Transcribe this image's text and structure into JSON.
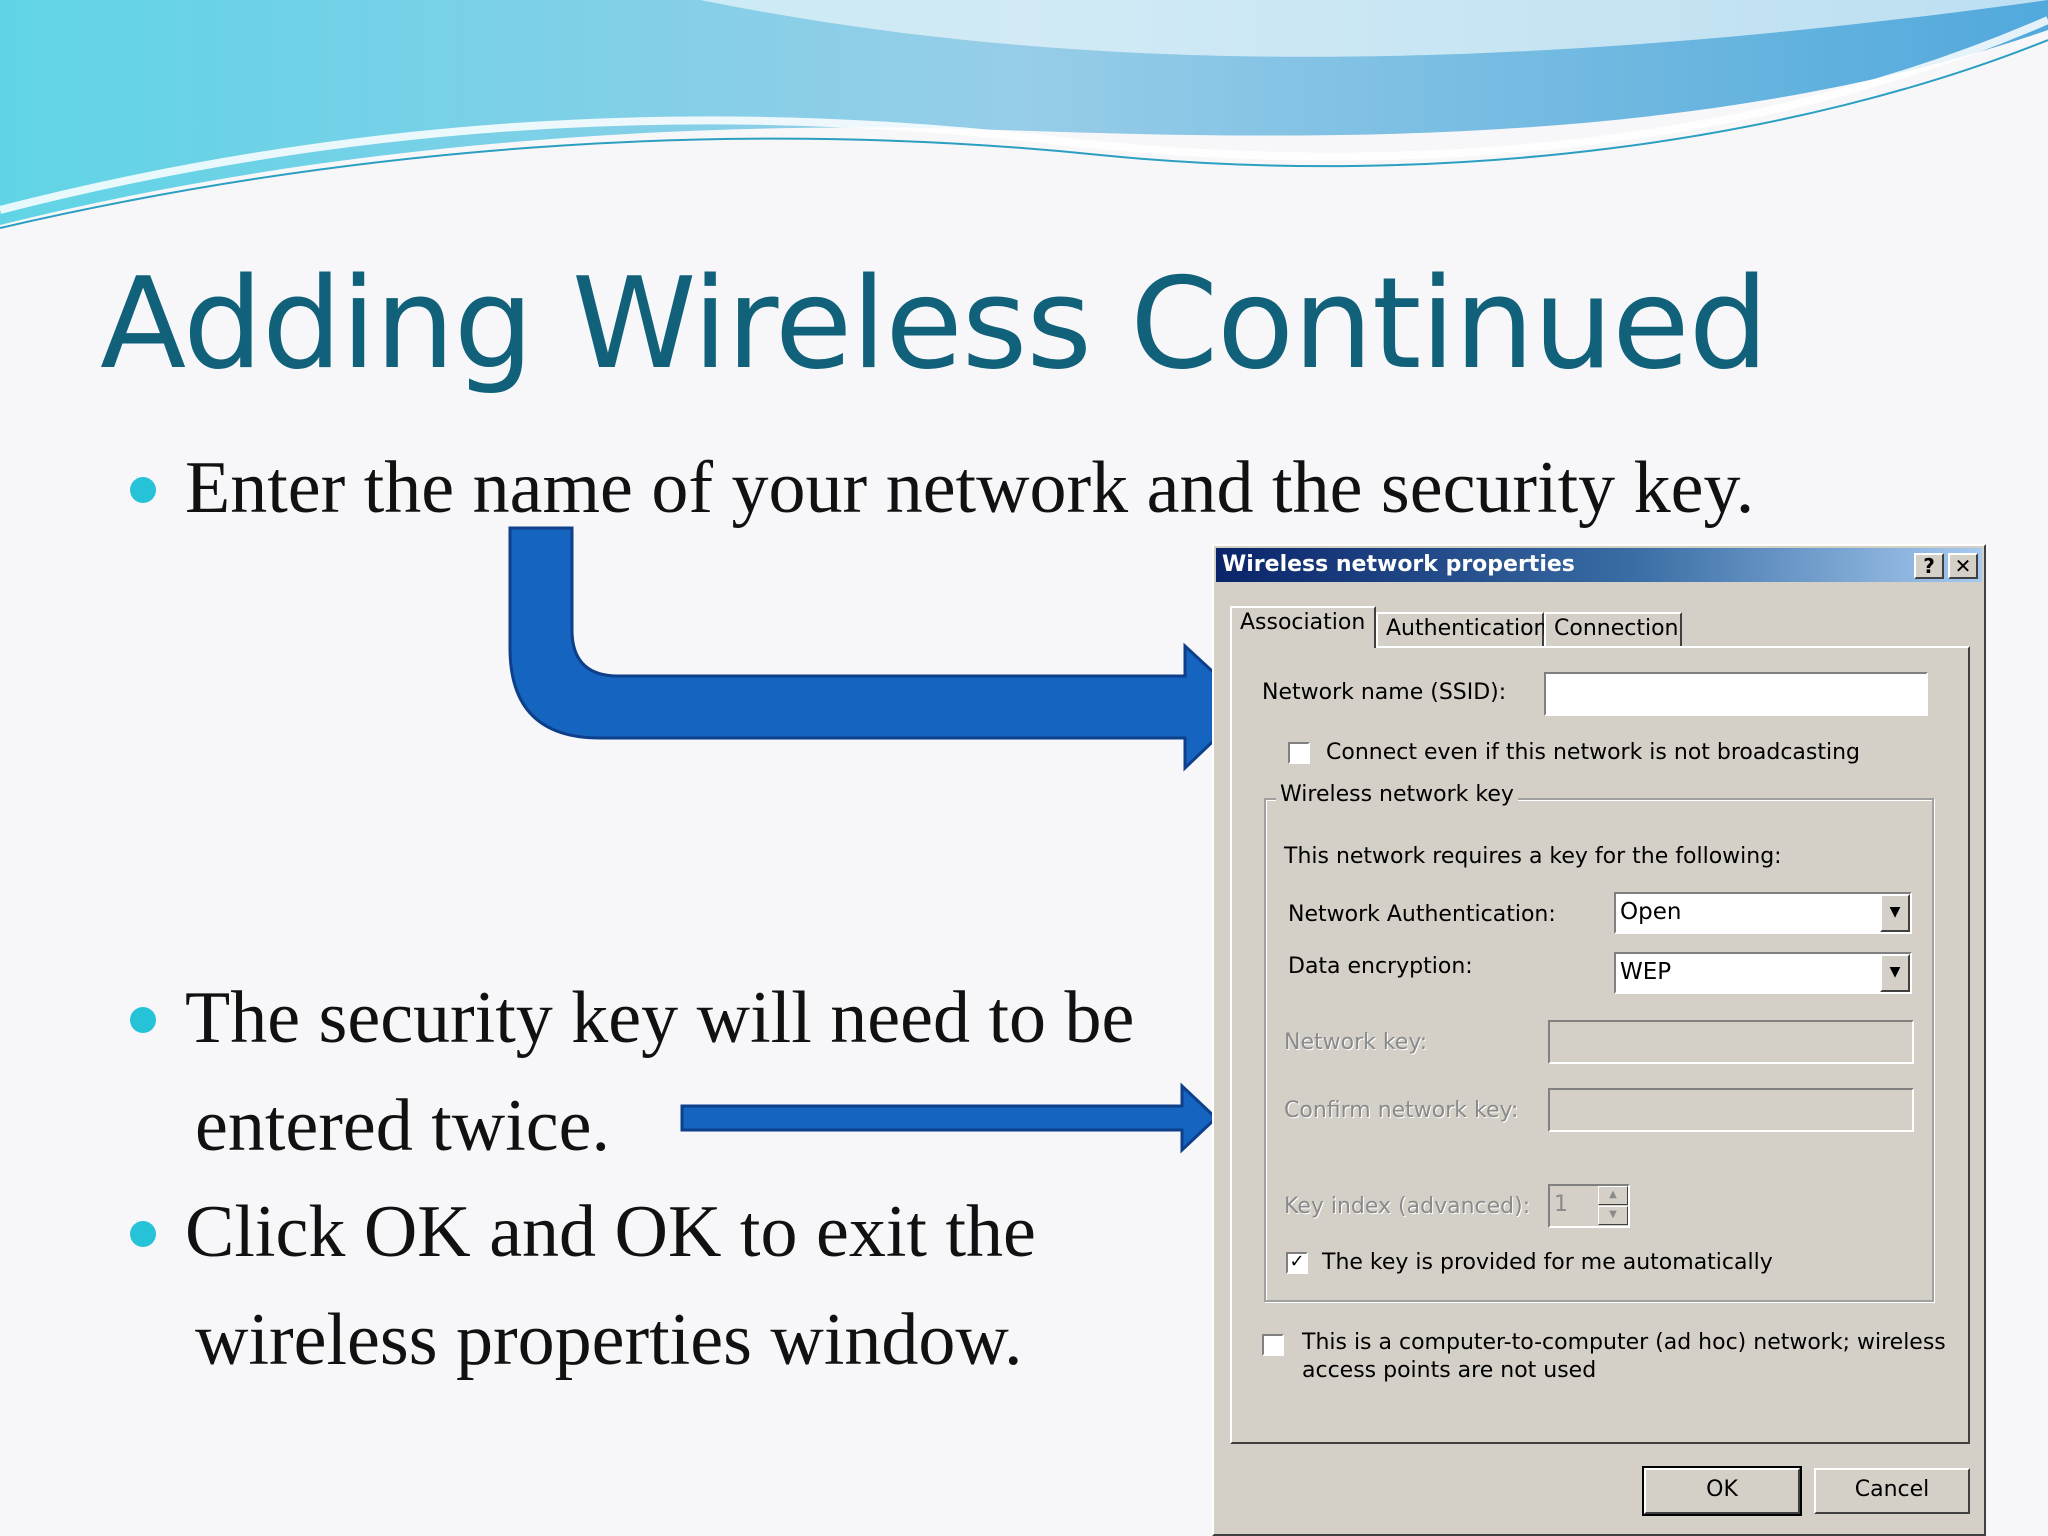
{
  "slide": {
    "title": "Adding Wireless Continued",
    "bullets": [
      "Enter the name of your network and the security key.",
      "The security key will need to be",
      "entered twice.",
      "Click OK and OK to exit the",
      "wireless properties window."
    ]
  },
  "dialog": {
    "title": "Wireless network properties",
    "help_button": "?",
    "close_button": "✕",
    "tabs": [
      "Association",
      "Authentication",
      "Connection"
    ],
    "active_tab": "Association",
    "network_name_label": "Network name (SSID):",
    "network_name_value": "",
    "connect_broadcast_label": "Connect even if this network is not broadcasting",
    "connect_broadcast_checked": false,
    "group_label": "Wireless network key",
    "requires_text": "This network requires a key for the following:",
    "auth_label": "Network Authentication:",
    "auth_value": "Open",
    "encryption_label": "Data encryption:",
    "encryption_value": "WEP",
    "network_key_label": "Network key:",
    "confirm_key_label": "Confirm network key:",
    "key_index_label": "Key index (advanced):",
    "key_index_value": "1",
    "auto_key_label": "The key is provided for me automatically",
    "auto_key_checked": true,
    "adhoc_label_line1": "This is a computer-to-computer (ad hoc) network; wireless",
    "adhoc_label_line2": "access points are not used",
    "adhoc_checked": false,
    "ok_button": "OK",
    "cancel_button": "Cancel"
  },
  "colors": {
    "title": "#12617a",
    "bullet_dot": "#26c3d8",
    "arrow": "#1565c0"
  }
}
